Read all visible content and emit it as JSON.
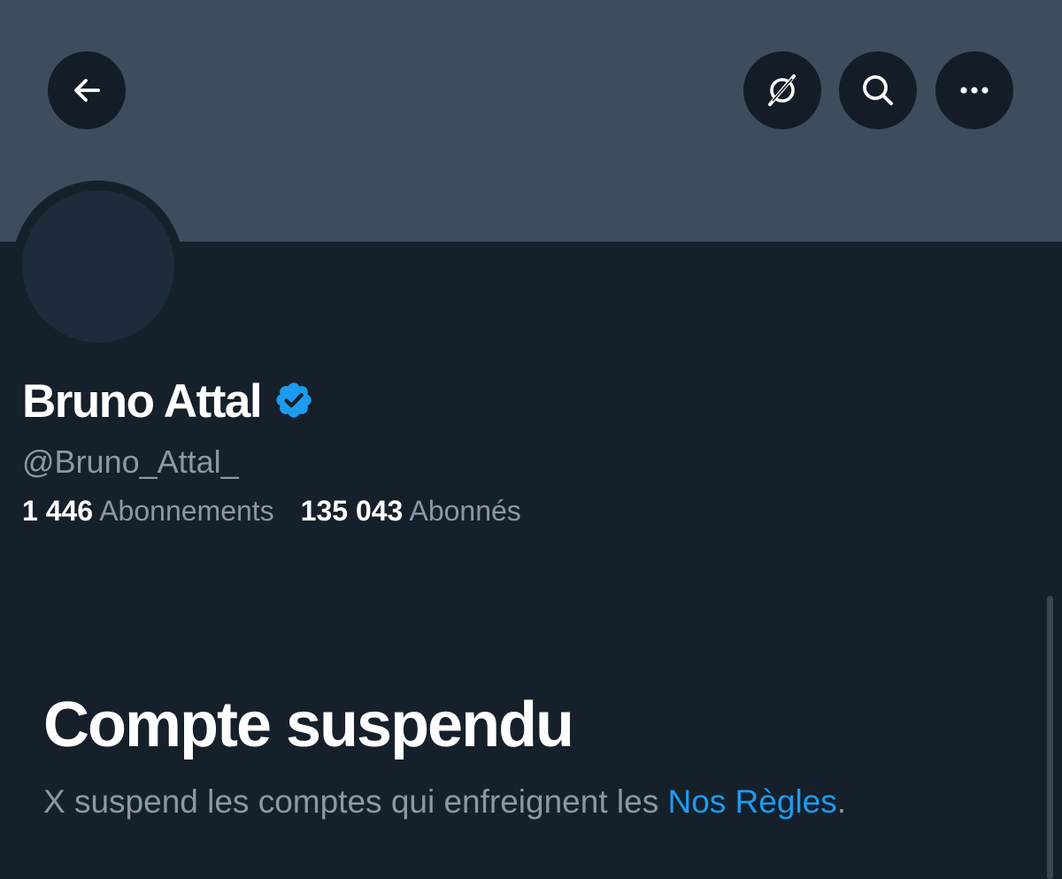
{
  "header": {
    "back_icon": "arrow-left-icon",
    "grok_icon": "grok-icon",
    "search_icon": "search-icon",
    "more_icon": "more-horizontal-icon"
  },
  "profile": {
    "display_name": "Bruno Attal",
    "verified_icon": "verified-badge-icon",
    "handle": "@Bruno_Attal_",
    "following_count": "1 446",
    "following_label": "Abonnements",
    "followers_count": "135 043",
    "followers_label": "Abonnés"
  },
  "notice": {
    "title": "Compte suspendu",
    "description": "X suspend les comptes qui enfreignent les ",
    "link_text": "Nos Règles",
    "trailing": "."
  },
  "colors": {
    "background": "#15202b",
    "banner": "#3e4d5e",
    "accent": "#1d9bf0",
    "secondary_text": "#8b98a5"
  }
}
